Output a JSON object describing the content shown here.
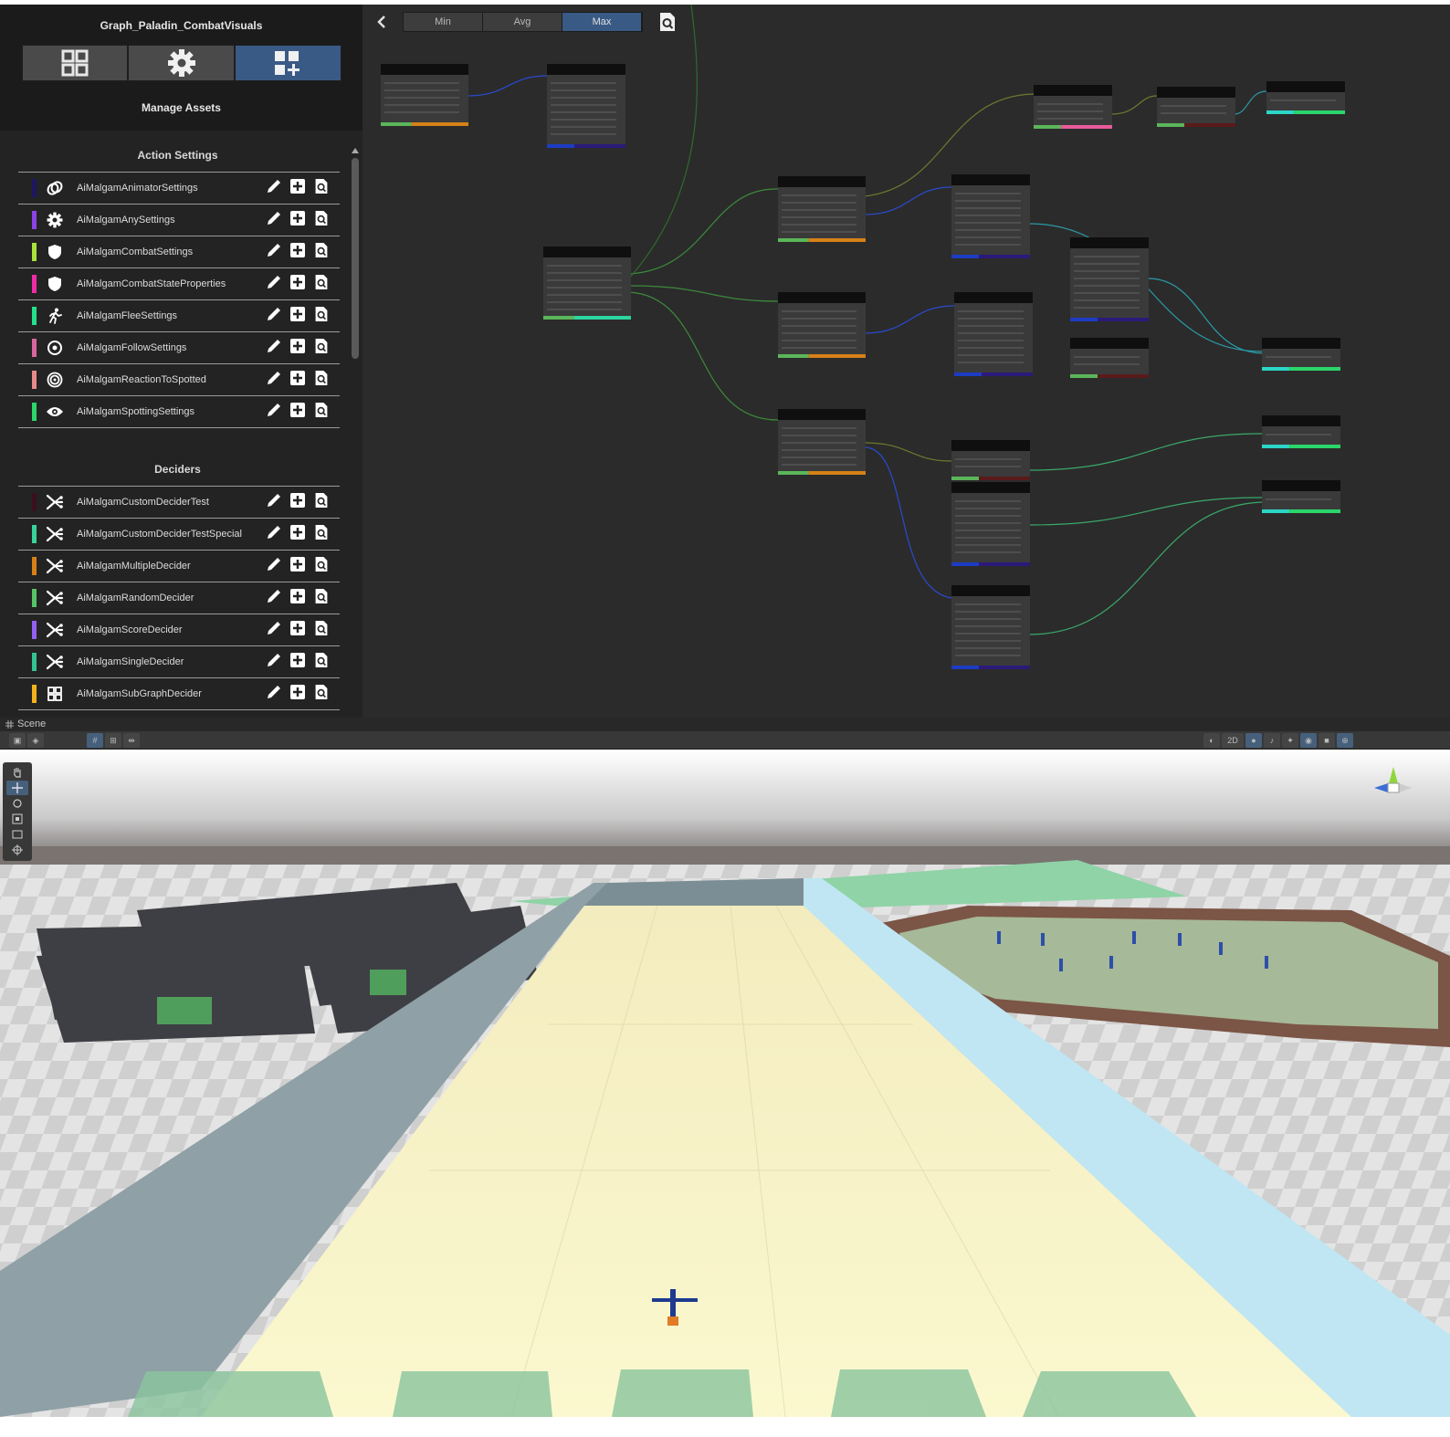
{
  "editor": {
    "graph_title": "Graph_Paladin_CombatVisuals",
    "mode_tabs": [
      {
        "icon": "grid-icon",
        "active": false
      },
      {
        "icon": "gear-icon",
        "active": false
      },
      {
        "icon": "grid-add-icon",
        "active": true
      }
    ],
    "panel_title": "Manage Assets",
    "sections": [
      {
        "title": "Action Settings",
        "items": [
          {
            "label": "AiMalgamAnimatorSettings",
            "color": "#1d1660",
            "icon": "link-icon"
          },
          {
            "label": "AiMalgamAnySettings",
            "color": "#8c43e6",
            "icon": "gear-icon"
          },
          {
            "label": "AiMalgamCombatSettings",
            "color": "#a8e23a",
            "icon": "shield-icon"
          },
          {
            "label": "AiMalgamCombatStateProperties",
            "color": "#ee2ca8",
            "icon": "shield-icon"
          },
          {
            "label": "AiMalgamFleeSettings",
            "color": "#24e08a",
            "icon": "running-icon"
          },
          {
            "label": "AiMalgamFollowSettings",
            "color": "#d5679e",
            "icon": "target-icon"
          },
          {
            "label": "AiMalgamReactionToSpotted",
            "color": "#e98a8a",
            "icon": "spiral-icon"
          },
          {
            "label": "AiMalgamSpottingSettings",
            "color": "#2bd66a",
            "icon": "eye-icon"
          }
        ]
      },
      {
        "title": "Deciders",
        "items": [
          {
            "label": "AiMalgamCustomDeciderTest",
            "color": "#3a1020",
            "icon": "decider-icon"
          },
          {
            "label": "AiMalgamCustomDeciderTestSpecial",
            "color": "#39d39a",
            "icon": "decider-icon"
          },
          {
            "label": "AiMalgamMultipleDecider",
            "color": "#d68117",
            "icon": "decider-icon"
          },
          {
            "label": "AiMalgamRandomDecider",
            "color": "#56c465",
            "icon": "decider-icon"
          },
          {
            "label": "AiMalgamScoreDecider",
            "color": "#9360f2",
            "icon": "decider-icon"
          },
          {
            "label": "AiMalgamSingleDecider",
            "color": "#34c290",
            "icon": "decider-icon"
          },
          {
            "label": "AiMalgamSubGraphDecider",
            "color": "#f2b21c",
            "icon": "grid-icon"
          }
        ]
      }
    ],
    "row_actions": [
      "edit-icon",
      "add-icon",
      "find-icon"
    ],
    "graph_toolbar": {
      "back_icon": "chevron-left-icon",
      "segments": [
        {
          "label": "Min",
          "active": false
        },
        {
          "label": "Avg",
          "active": false
        },
        {
          "label": "Max",
          "active": true
        }
      ],
      "find_icon": "find-icon"
    }
  },
  "scene": {
    "tab_label": "Scene",
    "toolbar_2d_label": "2D",
    "tools": [
      "hand-icon",
      "move-icon",
      "rotate-icon",
      "scale-icon",
      "rect-icon",
      "transform-icon"
    ],
    "active_tool": "move-icon"
  }
}
